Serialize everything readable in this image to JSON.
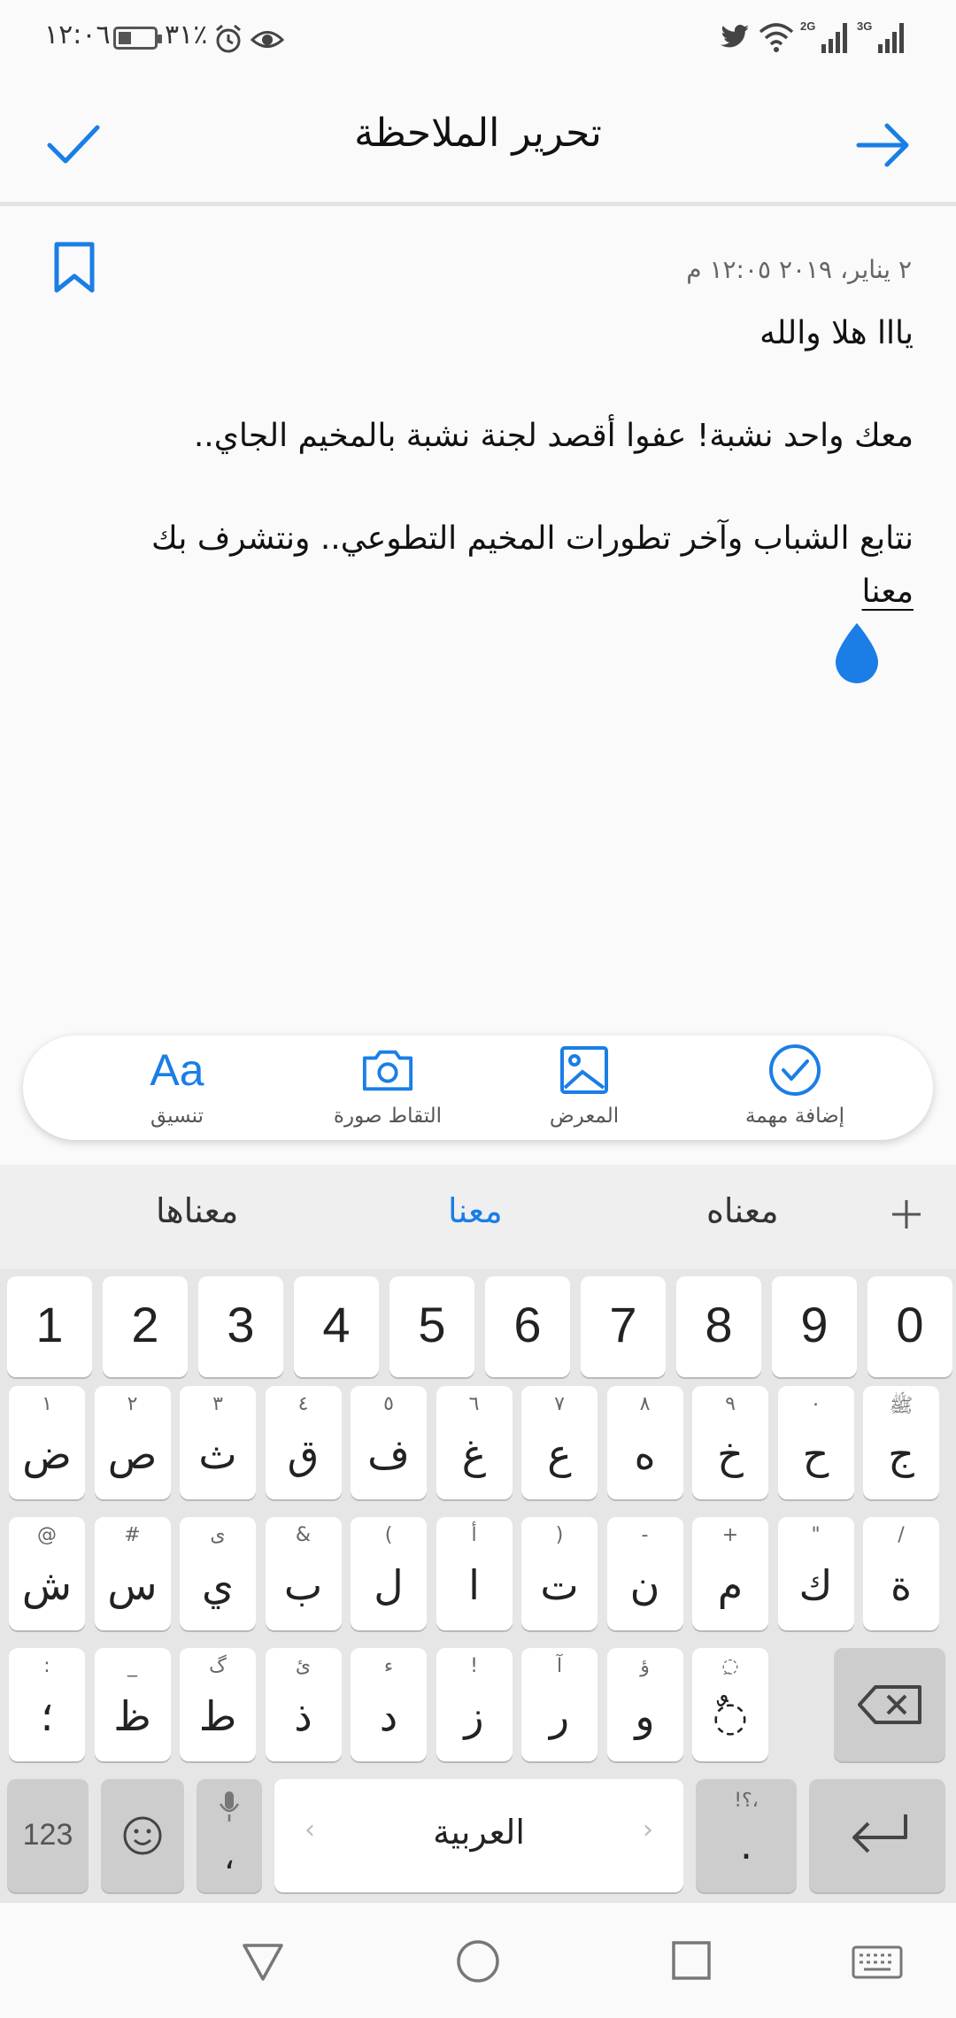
{
  "status_bar": {
    "time": "١٢:٠٦",
    "battery": "٣١٪",
    "network_1": "3G",
    "network_2": "2G"
  },
  "header": {
    "title": "تحرير الملاحظة"
  },
  "note": {
    "date": "٢ يناير، ٢٠١٩ ١٢:٠٥ م",
    "lines": [
      "يااا هلا والله",
      "معك واحد نشبة! عفوا أقصد لجنة نشبة بالمخيم الجاي..",
      "نتابع الشباب وآخر تطورات المخيم التطوعي.. ونتشرف بك"
    ],
    "cursor_word": "معنا"
  },
  "toolbar": {
    "format_label": "تنسيق",
    "format_glyph": "Aa",
    "camera_label": "التقاط صورة",
    "gallery_label": "المعرض",
    "task_label": "إضافة مهمة"
  },
  "suggestions": [
    "معناه",
    "معنا",
    "معناها"
  ],
  "keyboard": {
    "digits": [
      "1",
      "2",
      "3",
      "4",
      "5",
      "6",
      "7",
      "8",
      "9",
      "0"
    ],
    "row1": [
      {
        "main": "ج",
        "sub": "ﷺ"
      },
      {
        "main": "ح",
        "sub": "٠"
      },
      {
        "main": "خ",
        "sub": "٩"
      },
      {
        "main": "ه",
        "sub": "٨"
      },
      {
        "main": "ع",
        "sub": "٧"
      },
      {
        "main": "غ",
        "sub": "٦"
      },
      {
        "main": "ف",
        "sub": "٥"
      },
      {
        "main": "ق",
        "sub": "٤"
      },
      {
        "main": "ث",
        "sub": "٣"
      },
      {
        "main": "ص",
        "sub": "٢"
      },
      {
        "main": "ض",
        "sub": "١"
      }
    ],
    "row2": [
      {
        "main": "ة",
        "sub": "/"
      },
      {
        "main": "ك",
        "sub": "\""
      },
      {
        "main": "م",
        "sub": "+"
      },
      {
        "main": "ن",
        "sub": "-"
      },
      {
        "main": "ت",
        "sub": ")"
      },
      {
        "main": "ا",
        "sub": "أ"
      },
      {
        "main": "ل",
        "sub": "("
      },
      {
        "main": "ب",
        "sub": "&"
      },
      {
        "main": "ي",
        "sub": "ى"
      },
      {
        "main": "س",
        "sub": "#"
      },
      {
        "main": "ش",
        "sub": "@"
      }
    ],
    "row3": [
      {
        "main": "◌ٌ",
        "sub": "◌ِ"
      },
      {
        "main": "و",
        "sub": "ؤ"
      },
      {
        "main": "ر",
        "sub": "آ"
      },
      {
        "main": "ز",
        "sub": "!"
      },
      {
        "main": "د",
        "sub": "ء"
      },
      {
        "main": "ذ",
        "sub": "ئ"
      },
      {
        "main": "ط",
        "sub": "گ"
      },
      {
        "main": "ظ",
        "sub": "_"
      },
      {
        "main": "؛",
        "sub": ":"
      }
    ],
    "numbers_key": "123",
    "comma_key": "،",
    "space_label": "العربية",
    "period_key": ".",
    "period_sub": "!؟،"
  }
}
